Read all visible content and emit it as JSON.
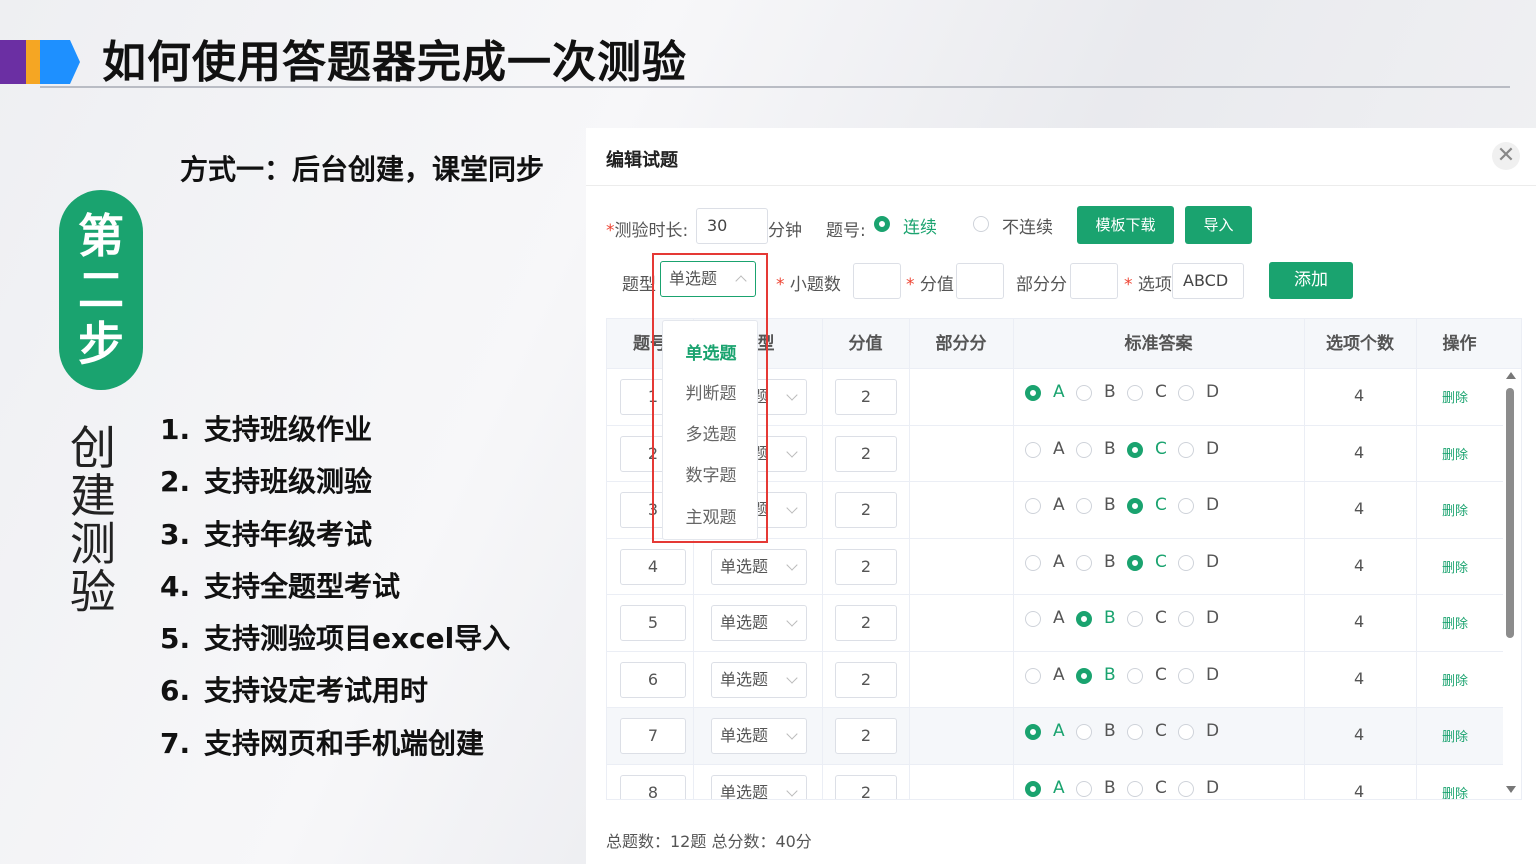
{
  "slide": {
    "title": "如何使用答题器完成一次测验",
    "subtitle": "方式一：后台创建，课堂同步",
    "step_label_chars": [
      "第",
      "二",
      "步"
    ],
    "vertical_title": "创建测验",
    "features": [
      {
        "num": "1.",
        "text": "支持班级作业"
      },
      {
        "num": "2.",
        "text": "支持班级测验"
      },
      {
        "num": "3.",
        "text": "支持年级考试"
      },
      {
        "num": "4.",
        "text": "支持全题型考试"
      },
      {
        "num": "5.",
        "text": "支持测验项目excel导入"
      },
      {
        "num": "6.",
        "text": "支持设定考试用时"
      },
      {
        "num": "7.",
        "text": "支持网页和手机端创建"
      }
    ]
  },
  "dialog": {
    "title": "编辑试题",
    "close": "✕",
    "form": {
      "duration_label": "测验时长:",
      "duration_value": "30",
      "duration_unit": "分钟",
      "numbering_label": "题号:",
      "numbering_continuous": "连续",
      "numbering_discontinuous": "不连续",
      "template_download": "模板下载",
      "import": "导入",
      "type_label": "题型",
      "type_value": "单选题",
      "subcount_label": "小题数",
      "score_label": "分值",
      "partial_label": "部分分",
      "options_label": "选项",
      "options_value": "ABCD",
      "add": "添加"
    },
    "dropdown": [
      "单选题",
      "判断题",
      "多选题",
      "数字题",
      "主观题"
    ],
    "table": {
      "headers": [
        "题号",
        "类型",
        "分值",
        "部分分",
        "标准答案",
        "选项个数",
        "操作"
      ],
      "option_letters": [
        "A",
        "B",
        "C",
        "D"
      ],
      "rows": [
        {
          "num": "1",
          "type": "单选题",
          "score": "2",
          "answer": "A",
          "count": "4",
          "op": "删除"
        },
        {
          "num": "2",
          "type": "单选题",
          "score": "2",
          "answer": "C",
          "count": "4",
          "op": "删除"
        },
        {
          "num": "3",
          "type": "单选题",
          "score": "2",
          "answer": "C",
          "count": "4",
          "op": "删除"
        },
        {
          "num": "4",
          "type": "单选题",
          "score": "2",
          "answer": "C",
          "count": "4",
          "op": "删除"
        },
        {
          "num": "5",
          "type": "单选题",
          "score": "2",
          "answer": "B",
          "count": "4",
          "op": "删除"
        },
        {
          "num": "6",
          "type": "单选题",
          "score": "2",
          "answer": "B",
          "count": "4",
          "op": "删除"
        },
        {
          "num": "7",
          "type": "单选题",
          "score": "2",
          "answer": "A",
          "count": "4",
          "op": "删除"
        },
        {
          "num": "8",
          "type": "单选题",
          "score": "2",
          "answer": "A",
          "count": "4",
          "op": "删除"
        }
      ]
    },
    "footer": "总题数：12题 总分数：40分"
  },
  "colors": {
    "accent": "#1aa36f",
    "highlight": "#e53935",
    "brand_purple": "#6b2fa3",
    "brand_orange": "#f5a623",
    "brand_blue": "#1e90ff"
  }
}
